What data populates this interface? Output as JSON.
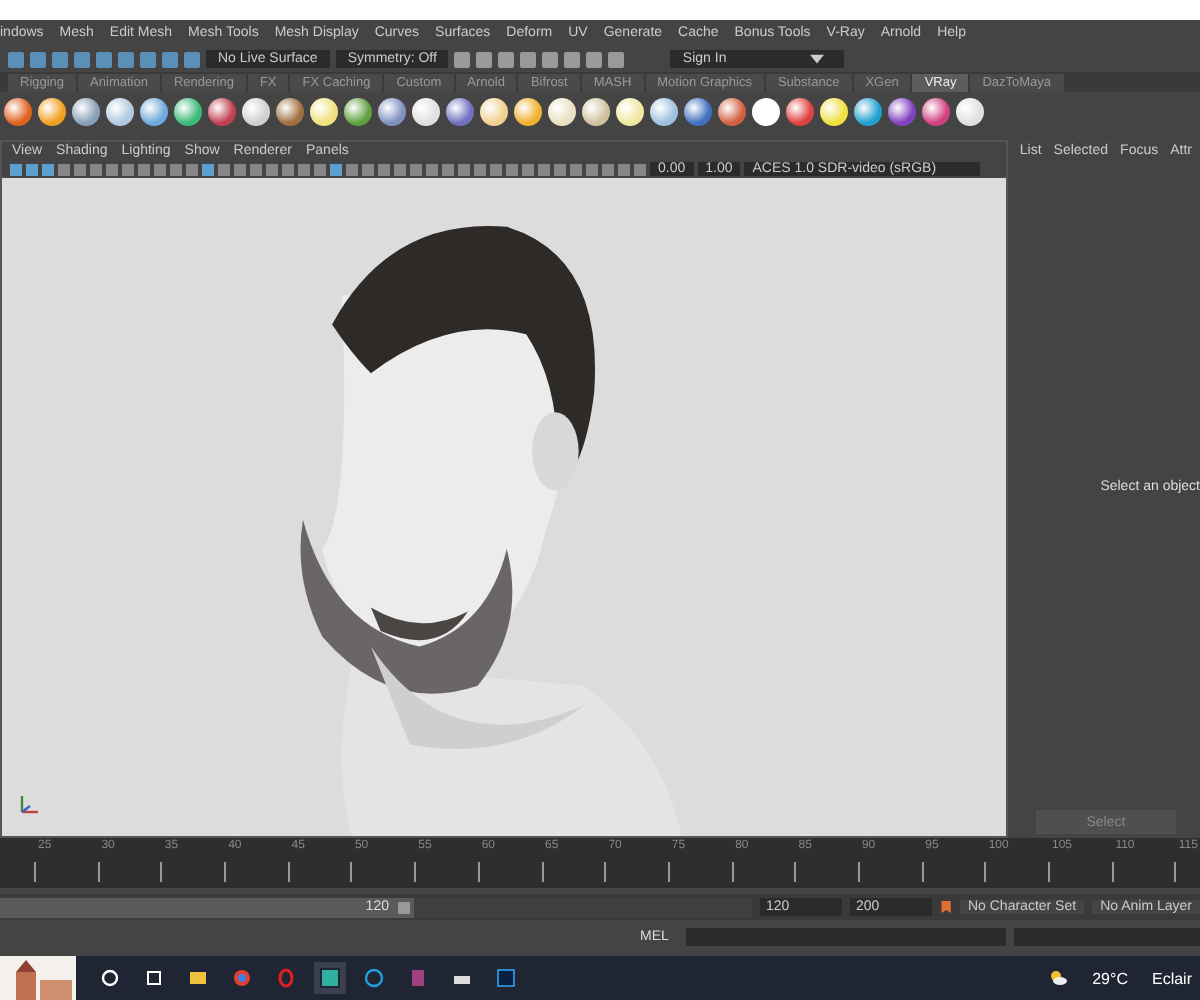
{
  "menu_bar": [
    "indows",
    "Mesh",
    "Edit Mesh",
    "Mesh Tools",
    "Mesh Display",
    "Curves",
    "Surfaces",
    "Deform",
    "UV",
    "Generate",
    "Cache",
    "Bonus Tools",
    "V-Ray",
    "Arnold",
    "Help"
  ],
  "status_line": {
    "live_surface": "No Live Surface",
    "symmetry": "Symmetry: Off",
    "sign_in": "Sign In"
  },
  "shelf_tabs": [
    {
      "label": "Rigging",
      "selected": false
    },
    {
      "label": "Animation",
      "selected": false
    },
    {
      "label": "Rendering",
      "selected": false
    },
    {
      "label": "FX",
      "selected": false
    },
    {
      "label": "FX Caching",
      "selected": false
    },
    {
      "label": "Custom",
      "selected": false
    },
    {
      "label": "Arnold",
      "selected": false
    },
    {
      "label": "Bifrost",
      "selected": false
    },
    {
      "label": "MASH",
      "selected": false
    },
    {
      "label": "Motion Graphics",
      "selected": false
    },
    {
      "label": "Substance",
      "selected": false
    },
    {
      "label": "XGen",
      "selected": false
    },
    {
      "label": "VRay",
      "selected": true
    },
    {
      "label": "DazToMaya",
      "selected": false
    }
  ],
  "viewport": {
    "menu": [
      "View",
      "Shading",
      "Lighting",
      "Show",
      "Renderer",
      "Panels"
    ],
    "exposure": "0.00",
    "gamma": "1.00",
    "color_space": "ACES 1.0 SDR-video (sRGB)"
  },
  "attribute_panel": {
    "tabs": [
      "List",
      "Selected",
      "Focus",
      "Attr"
    ],
    "message": "Select an object",
    "button": "Select"
  },
  "timeline": {
    "ticks": [
      "25",
      "30",
      "35",
      "40",
      "45",
      "50",
      "55",
      "60",
      "65",
      "70",
      "75",
      "80",
      "85",
      "90",
      "95",
      "100",
      "105",
      "110",
      "115"
    ]
  },
  "range": {
    "level": 0.55,
    "slider_end": "120",
    "end": "120",
    "max": "200",
    "character_set": "No Character Set",
    "anim_layer": "No Anim Layer"
  },
  "command_line": {
    "label": "MEL"
  },
  "taskbar": {
    "temperature": "29°C",
    "weather": "Eclair"
  }
}
